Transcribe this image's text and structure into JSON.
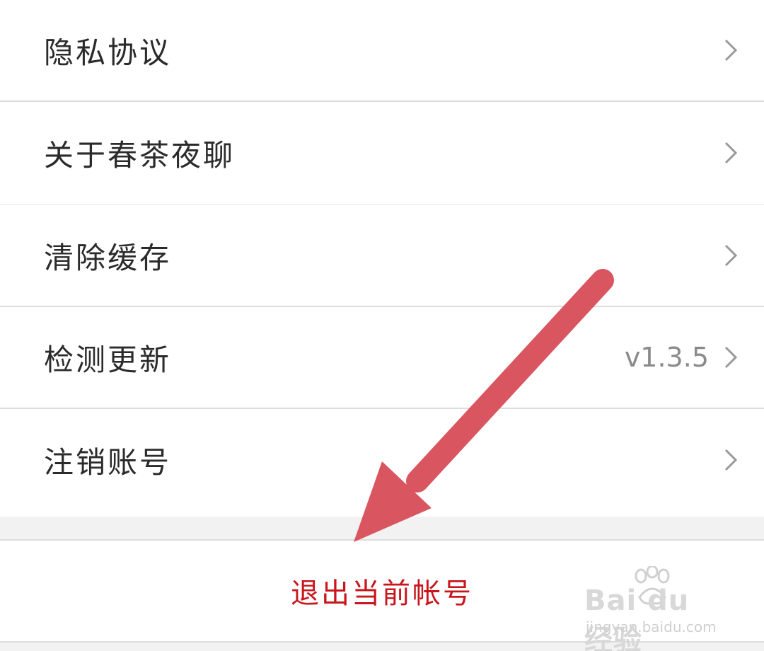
{
  "menu": {
    "privacy_label": "隐私协议",
    "about_label": "关于春茶夜聊",
    "clear_cache_label": "清除缓存",
    "check_update_label": "检测更新",
    "check_update_value": "v1.3.5",
    "cancel_account_label": "注销账号"
  },
  "logout": {
    "label": "退出当前帐号",
    "color": "#c8161d"
  },
  "annotation": {
    "arrow_color": "#d95560"
  },
  "watermark": {
    "brand": "Bai du 经验",
    "site": "jingyan.baidu.com"
  }
}
